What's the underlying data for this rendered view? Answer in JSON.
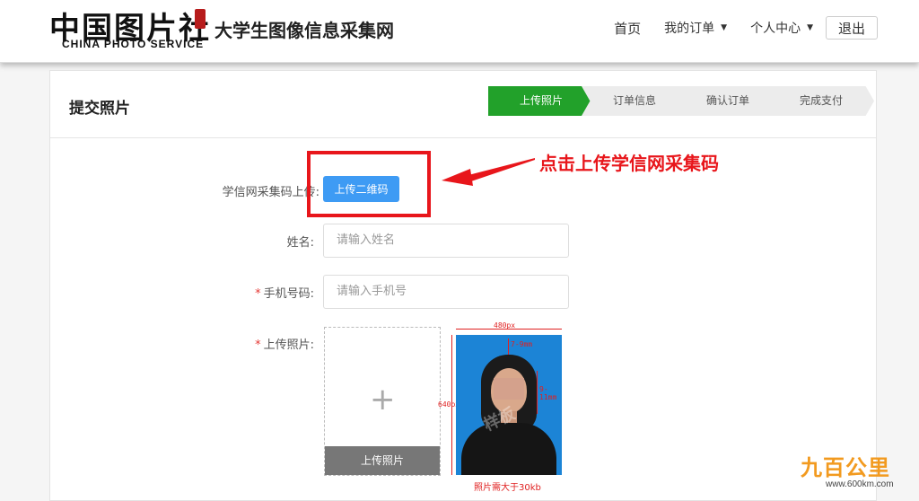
{
  "header": {
    "logo_cn": "中国图片社",
    "logo_en": "CHINA PHOTO SERVICE",
    "site_name": "大学生图像信息采集网",
    "nav": {
      "home": "首页",
      "my_orders": "我的订单",
      "personal_center": "个人中心",
      "logout": "退出"
    }
  },
  "panel": {
    "title": "提交照片",
    "steps": [
      "上传照片",
      "订单信息",
      "确认订单",
      "完成支付"
    ],
    "active_step": 0
  },
  "form": {
    "qr_label": "学信网采集码上传:",
    "qr_button": "上传二维码",
    "name_label": "姓名:",
    "name_placeholder": "请输入姓名",
    "phone_label": "手机号码:",
    "phone_placeholder": "请输入手机号",
    "photo_label": "上传照片:",
    "photo_button": "上传照片",
    "required_mark": "*"
  },
  "sample_photo": {
    "width_label": "480px",
    "height_label": "640px",
    "top_margin_label": "7-9mm",
    "side_label": "9-11mm",
    "watermark": "样板",
    "caption": "照片需大于30kb"
  },
  "annotation": {
    "callout_text": "点击上传学信网采集码"
  },
  "watermark_brand": {
    "name": "九百公里",
    "url": "www.600km.com"
  },
  "colors": {
    "active_step": "#22a12a",
    "primary_button": "#3e9bf4",
    "annotation_red": "#e8161b",
    "sample_bg": "#1c84d6"
  }
}
